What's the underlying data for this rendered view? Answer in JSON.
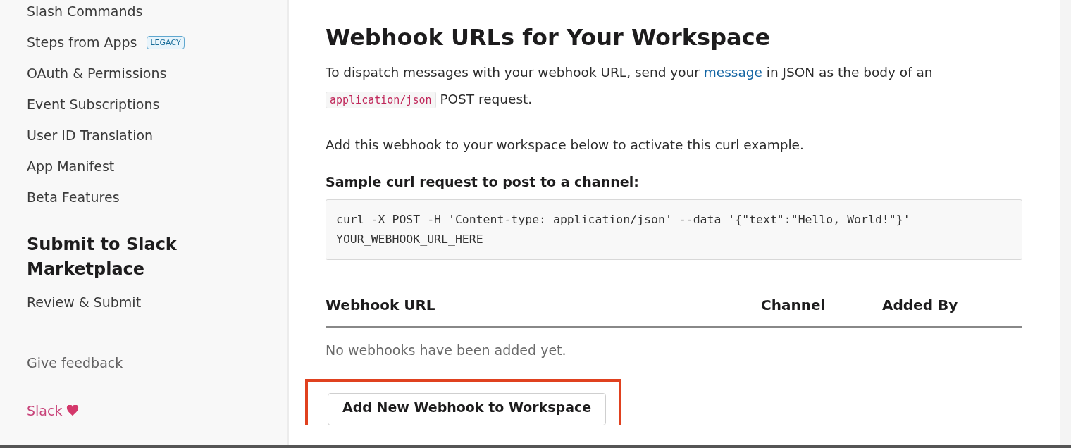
{
  "sidebar": {
    "items": [
      {
        "label": "Slash Commands"
      },
      {
        "label": "Steps from Apps",
        "badge": "LEGACY"
      },
      {
        "label": "OAuth & Permissions"
      },
      {
        "label": "Event Subscriptions"
      },
      {
        "label": "User ID Translation"
      },
      {
        "label": "App Manifest"
      },
      {
        "label": "Beta Features"
      }
    ],
    "section_title": "Submit to Slack Marketplace",
    "section_items": [
      "Review & Submit"
    ],
    "feedback": "Give feedback",
    "brand": "Slack"
  },
  "main": {
    "title": "Webhook URLs for Your Workspace",
    "intro": [
      {
        "kind": "text",
        "text": "To dispatch messages with your webhook URL, send your "
      },
      {
        "kind": "link",
        "text": "message"
      },
      {
        "kind": "text",
        "text": " in JSON as the body of an "
      },
      {
        "kind": "code",
        "text": "application/json"
      },
      {
        "kind": "text",
        "text": " POST request."
      }
    ],
    "note": "Add this webhook to your workspace below to activate this curl example.",
    "sample_label": "Sample curl request to post to a channel:",
    "sample_code": "curl -X POST -H 'Content-type: application/json' --data '{\"text\":\"Hello, World!\"}' YOUR_WEBHOOK_URL_HERE",
    "table": {
      "columns": [
        "Webhook URL",
        "Channel",
        "Added By"
      ],
      "empty": "No webhooks have been added yet."
    },
    "add_button": {
      "label": "Add New Webhook to Workspace",
      "highlighted": true
    }
  }
}
